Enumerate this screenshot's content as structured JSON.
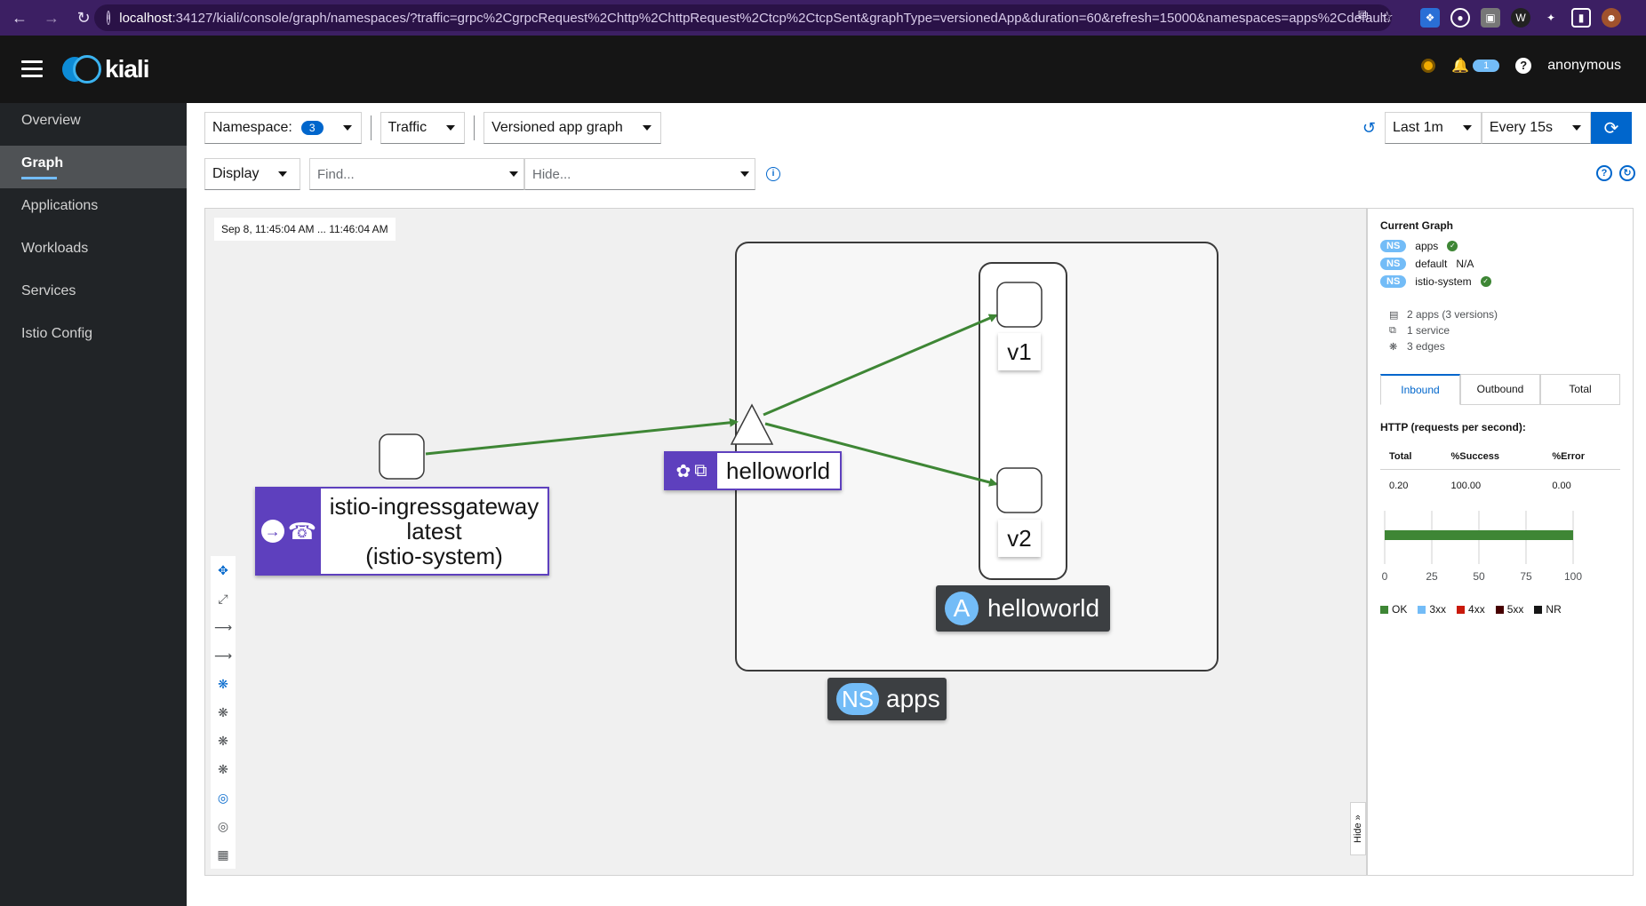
{
  "browser": {
    "url_host": "localhost",
    "url_rest": ":34127/kiali/console/graph/namespaces/?traffic=grpc%2CgrpcRequest%2Chttp%2ChttpRequest%2Ctcp%2CtcpSent&graphType=versionedApp&duration=60&refresh=15000&namespaces=apps%2Cdefault..."
  },
  "masthead": {
    "brand": "kiali",
    "notification_count": "1",
    "user": "anonymous"
  },
  "sidebar": {
    "items": [
      {
        "label": "Overview"
      },
      {
        "label": "Graph"
      },
      {
        "label": "Applications"
      },
      {
        "label": "Workloads"
      },
      {
        "label": "Services"
      },
      {
        "label": "Istio Config"
      }
    ]
  },
  "toolbar": {
    "namespace_label": "Namespace:",
    "namespace_count": "3",
    "traffic_label": "Traffic",
    "graph_type_label": "Versioned app graph",
    "duration_label": "Last 1m",
    "refresh_label": "Every 15s",
    "display_label": "Display",
    "find_placeholder": "Find...",
    "hide_placeholder": "Hide..."
  },
  "graph": {
    "timestamp": "Sep 8, 11:45:04 AM ... 11:46:04 AM",
    "ingress_name": "istio-ingressgateway",
    "ingress_version": "latest",
    "ingress_namespace": "(istio-system)",
    "service_name": "helloworld",
    "v1_label": "v1",
    "v2_label": "v2",
    "app_badge": "A",
    "app_name": "helloworld",
    "ns_badge": "NS",
    "ns_name": "apps",
    "hide_label": "Hide",
    "edge_color": "#3e8635"
  },
  "panel": {
    "title": "Current Graph",
    "namespaces": [
      {
        "badge": "NS",
        "name": "apps",
        "status": "ok"
      },
      {
        "badge": "NS",
        "name": "default",
        "status": "N/A"
      },
      {
        "badge": "NS",
        "name": "istio-system",
        "status": "ok"
      }
    ],
    "stats": {
      "apps": "2 apps (3 versions)",
      "services": "1 service",
      "edges": "3 edges"
    },
    "tabs": [
      "Inbound",
      "Outbound",
      "Total"
    ],
    "http_title": "HTTP (requests per second):",
    "table_headers": [
      "Total",
      "%Success",
      "%Error"
    ],
    "table_row": [
      "0.20",
      "100.00",
      "0.00"
    ],
    "axis_ticks": [
      "0",
      "25",
      "50",
      "75",
      "100"
    ],
    "ok_percent": 100,
    "legend": [
      {
        "label": "OK",
        "color": "#3e8635"
      },
      {
        "label": "3xx",
        "color": "#73bcf7"
      },
      {
        "label": "4xx",
        "color": "#c9190b"
      },
      {
        "label": "5xx",
        "color": "#470000"
      },
      {
        "label": "NR",
        "color": "#151515"
      }
    ]
  }
}
